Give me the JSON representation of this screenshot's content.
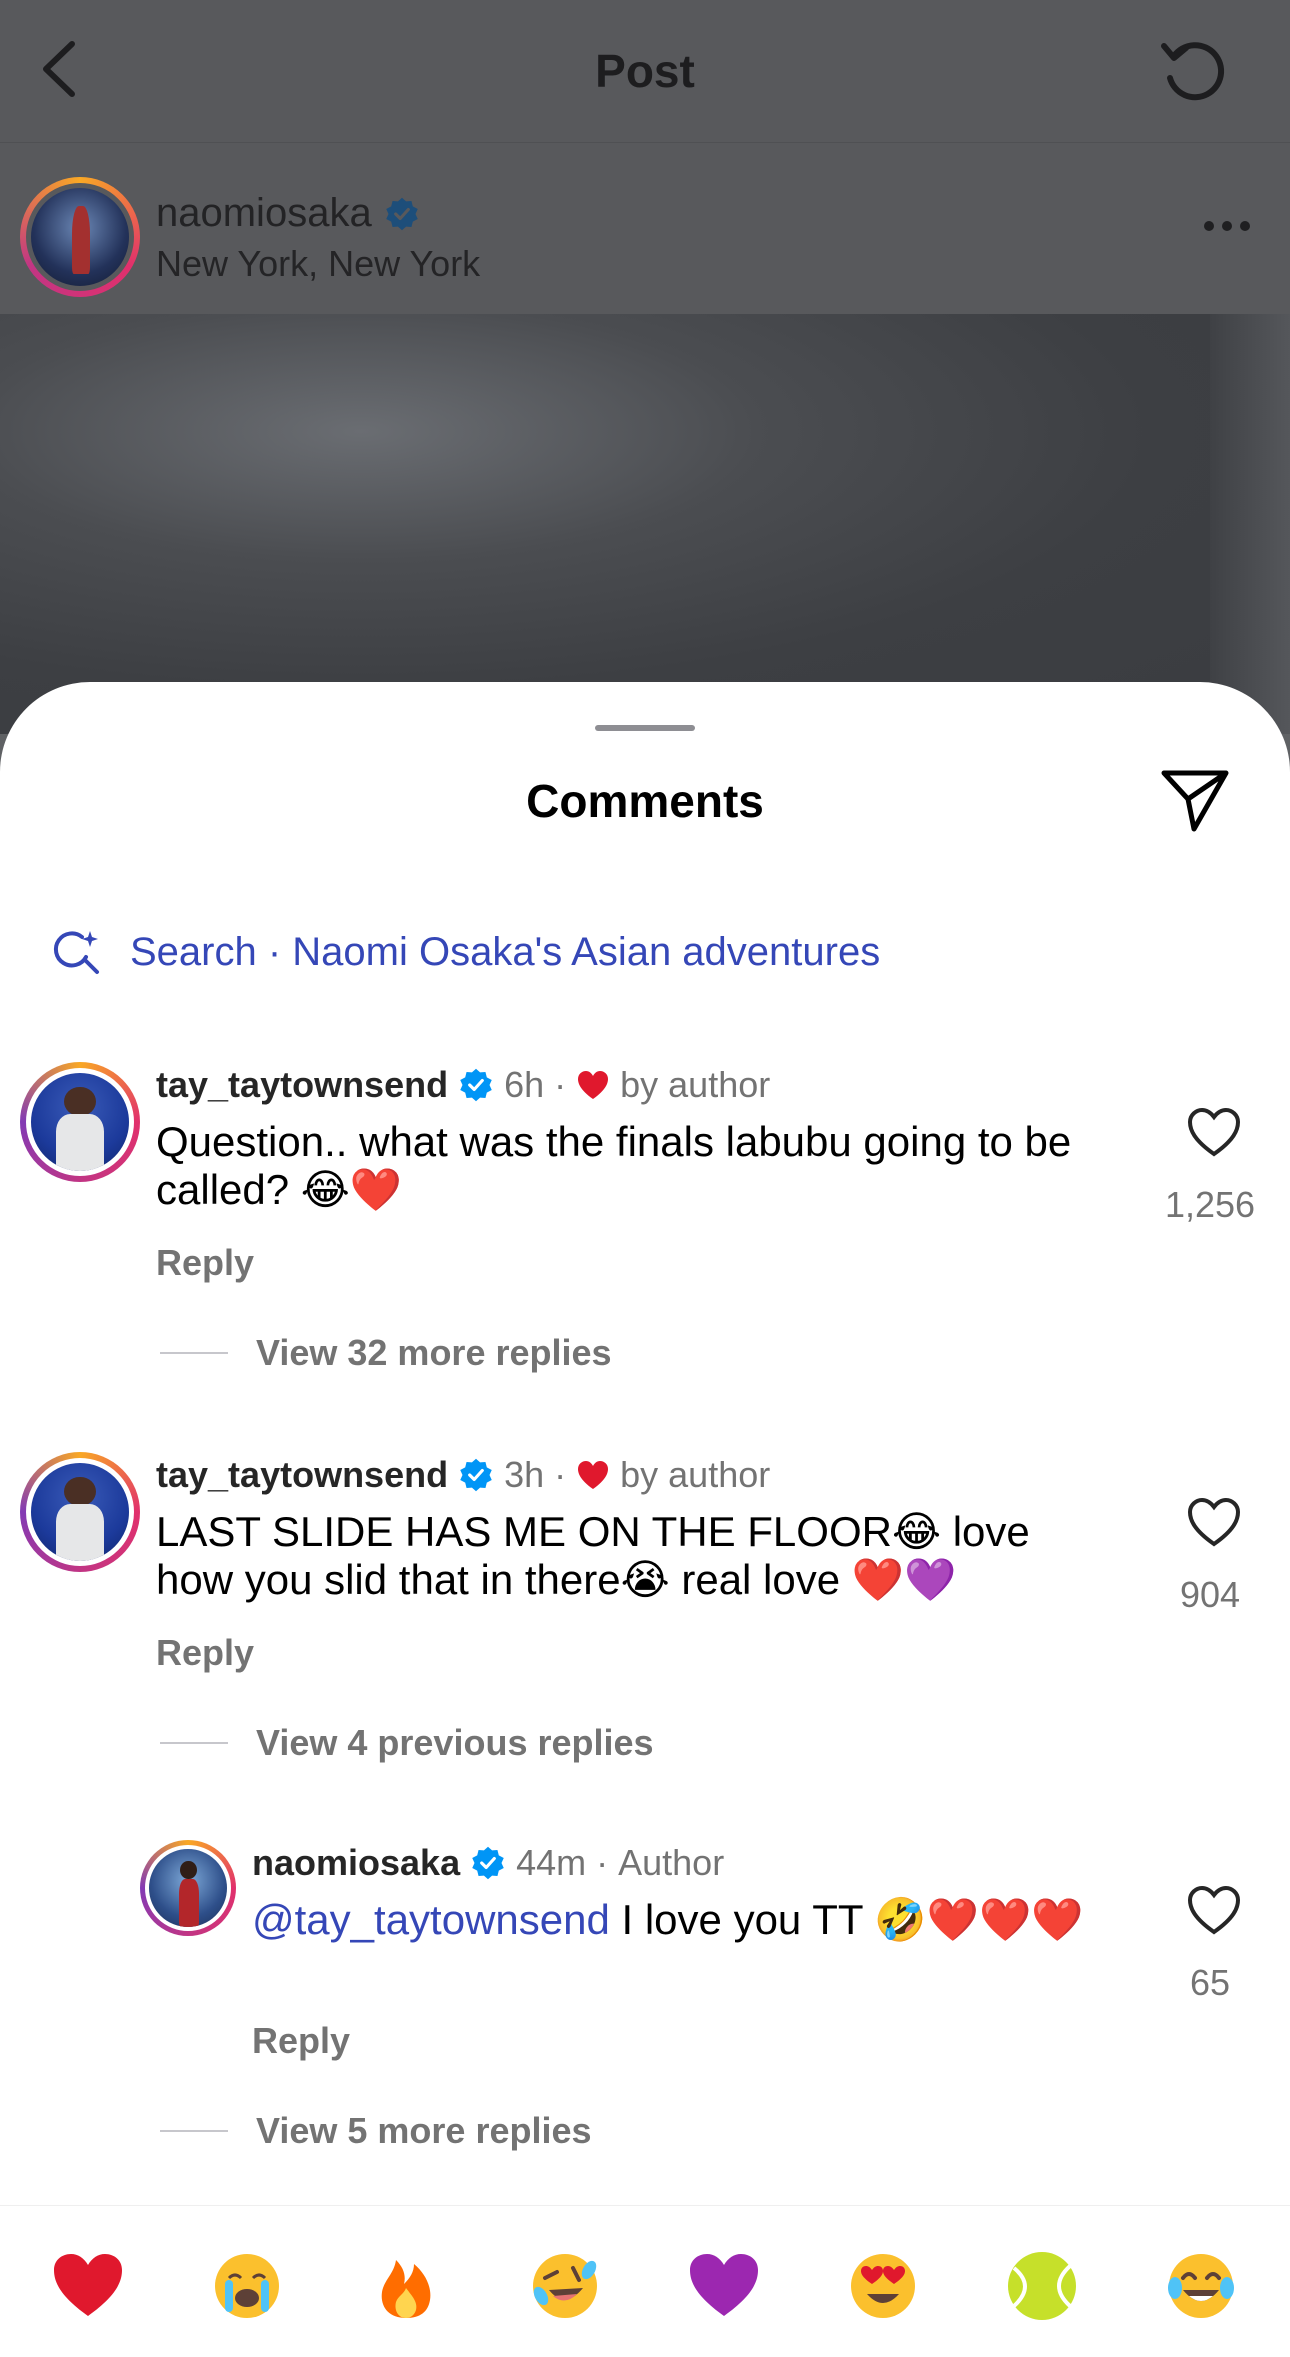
{
  "header": {
    "title": "Post"
  },
  "post": {
    "username": "naomiosaka",
    "location": "New York, New York"
  },
  "sheet": {
    "title": "Comments",
    "search_text": "Search · Naomi Osaka's Asian adventures"
  },
  "comments": [
    {
      "username": "tay_taytownsend",
      "time": "6h",
      "liked_by": "by author",
      "text": "Question.. what was the finals labubu going to be called? 😂❤️",
      "reply_label": "Reply",
      "likes": "1,256",
      "view_replies": "View 32 more replies"
    },
    {
      "username": "tay_taytownsend",
      "time": "3h",
      "liked_by": "by author",
      "text": "LAST SLIDE HAS ME ON THE FLOOR😂 love how you slid that in there😭 real love ❤️💜",
      "reply_label": "Reply",
      "likes": "904",
      "view_replies": "View 4 previous replies"
    },
    {
      "username": "naomiosaka",
      "time": "44m",
      "author_label": "Author",
      "mention": "@tay_taytownsend",
      "text": " I love you TT 🤣❤️❤️❤️",
      "reply_label": "Reply",
      "likes": "65",
      "view_replies": "View 5 more replies"
    }
  ],
  "emoji_bar": [
    "red-heart",
    "loudly-crying",
    "fire",
    "rolling-laughing",
    "purple-heart",
    "heart-eyes",
    "tennis-ball",
    "tears-of-joy"
  ],
  "colors": {
    "link_blue": "#3547b7",
    "verified_blue": "#0095f6",
    "secondary_text": "#737373",
    "heart_red": "#e0182d"
  }
}
